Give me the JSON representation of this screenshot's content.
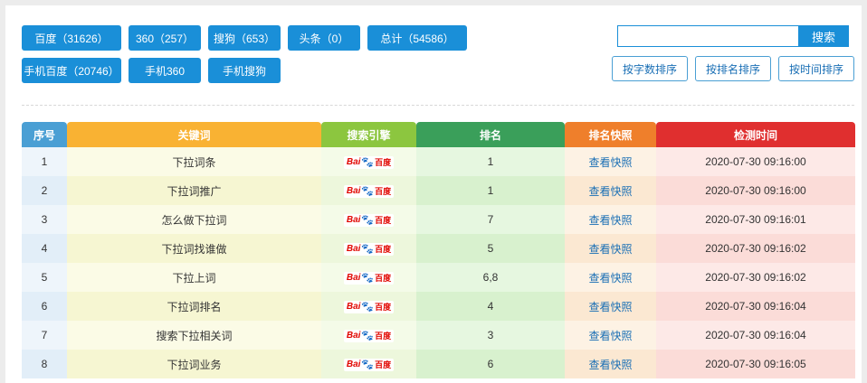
{
  "filters": {
    "row1": [
      {
        "label": "百度（31626）"
      },
      {
        "label": "360（257）"
      },
      {
        "label": "搜狗（653）"
      },
      {
        "label": "头条（0）"
      },
      {
        "label": "总计（54586）"
      }
    ],
    "row2": [
      {
        "label": "手机百度（20746）"
      },
      {
        "label": "手机360"
      },
      {
        "label": "手机搜狗"
      }
    ]
  },
  "search": {
    "value": "",
    "button_label": "搜索"
  },
  "sort_buttons": [
    "按字数排序",
    "按排名排序",
    "按时间排序"
  ],
  "table": {
    "headers": [
      "序号",
      "关键词",
      "搜索引擎",
      "排名",
      "排名快照",
      "检测时间"
    ],
    "engine_logo": {
      "bai": "Bai",
      "paw": "🐾",
      "du": "百度"
    },
    "rows": [
      {
        "no": "1",
        "keyword": "下拉词条",
        "rank": "1",
        "snapshot": "查看快照",
        "time": "2020-07-30 09:16:00"
      },
      {
        "no": "2",
        "keyword": "下拉词推广",
        "rank": "1",
        "snapshot": "查看快照",
        "time": "2020-07-30 09:16:00"
      },
      {
        "no": "3",
        "keyword": "怎么做下拉词",
        "rank": "7",
        "snapshot": "查看快照",
        "time": "2020-07-30 09:16:01"
      },
      {
        "no": "4",
        "keyword": "下拉词找谁做",
        "rank": "5",
        "snapshot": "查看快照",
        "time": "2020-07-30 09:16:02"
      },
      {
        "no": "5",
        "keyword": "下拉上词",
        "rank": "6,8",
        "snapshot": "查看快照",
        "time": "2020-07-30 09:16:02"
      },
      {
        "no": "6",
        "keyword": "下拉词排名",
        "rank": "4",
        "snapshot": "查看快照",
        "time": "2020-07-30 09:16:04"
      },
      {
        "no": "7",
        "keyword": "搜索下拉相关词",
        "rank": "3",
        "snapshot": "查看快照",
        "time": "2020-07-30 09:16:04"
      },
      {
        "no": "8",
        "keyword": "下拉词业务",
        "rank": "6",
        "snapshot": "查看快照",
        "time": "2020-07-30 09:16:05"
      }
    ]
  }
}
